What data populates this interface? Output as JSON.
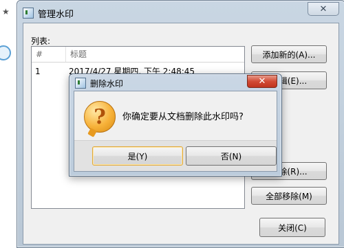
{
  "window": {
    "title": "管理水印",
    "close_glyph": "✕"
  },
  "list": {
    "label": "列表:",
    "columns": [
      "#",
      "标题"
    ],
    "rows": [
      {
        "num": "1",
        "title": "2017/4/27 星期四, 下午 2:48:45"
      }
    ]
  },
  "buttons": {
    "add": "添加新的(A)...",
    "edit": "编辑(E)...",
    "remove": "移除(R)...",
    "remove_all": "全部移除(M)",
    "close": "关闭(C)"
  },
  "dialog": {
    "title": "删除水印",
    "close_glyph": "✕",
    "icon": "question-icon",
    "message": "你确定要从文档删除此水印吗?",
    "yes": "是(Y)",
    "no": "否(N)"
  }
}
